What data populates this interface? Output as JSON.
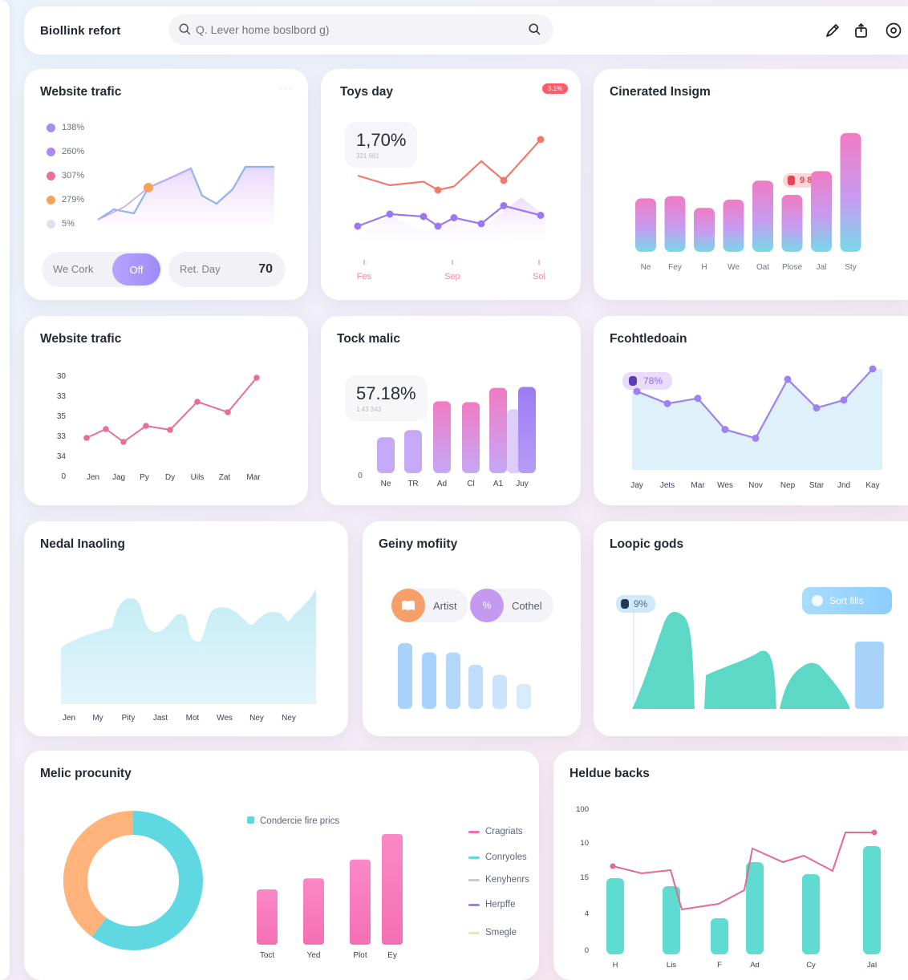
{
  "header": {
    "app_title": "Biollink refort",
    "search_placeholder": "Q. Lever home boslbord g)",
    "icons": [
      "search-icon",
      "pencil-icon",
      "share-icon",
      "settings-icon"
    ]
  },
  "cards": {
    "traffic1": {
      "title": "Website trafic",
      "legend": [
        {
          "label": "138%",
          "color": "#a88cf5"
        },
        {
          "label": "260%",
          "color": "#a88cf5"
        },
        {
          "label": "307%",
          "color": "#ee6f9e"
        },
        {
          "label": "279%",
          "color": "#f5a25d"
        },
        {
          "label": "5%",
          "color": "#dfe0ea"
        }
      ],
      "pill_label": "We Cork",
      "toggle_label": "Off",
      "day_label": "Ret. Day",
      "day_value": "70"
    },
    "toys": {
      "title": "Toys day",
      "badge": "3.1%",
      "stat": "1,70%",
      "stat_sub": "321 661",
      "x_labels": [
        "Fes",
        "Sep",
        "Sol"
      ]
    },
    "generated": {
      "title": "Cinerated Insigm",
      "badge": "9 854",
      "categories": [
        "Ne",
        "Fey",
        "H",
        "We",
        "Oat",
        "Plose",
        "Jal",
        "Sty"
      ]
    },
    "traffic2": {
      "title": "Website trafic",
      "y_labels": [
        "30",
        "33",
        "35",
        "33",
        "34",
        "0"
      ],
      "x_labels": [
        "Jen",
        "Jag",
        "Py",
        "Dy",
        "Uils",
        "Zat",
        "Mar"
      ]
    },
    "tock": {
      "title": "Tock malic",
      "stat": "57.18%",
      "stat_sub": "1.43 343",
      "zero": "0",
      "categories": [
        "Ne",
        "TR",
        "Ad",
        "Cl",
        "A1",
        "Juy"
      ]
    },
    "feeled": {
      "title": "Fcohtledoain",
      "badge": "78%",
      "x_labels": [
        "Jay",
        "Jets",
        "Mar",
        "Wes",
        "Nov",
        "Nep",
        "Star",
        "Jnd",
        "Kay"
      ]
    },
    "nodal": {
      "title": "Nedal Inaoling",
      "x_labels": [
        "Jen",
        "My",
        "Pity",
        "Jast",
        "Mot",
        "Wes",
        "Ney",
        "Ney"
      ]
    },
    "geiny": {
      "title": "Geiny mofiity",
      "chip1": "Artist",
      "chip2": "Cothel"
    },
    "loopic": {
      "title": "Loopic gods",
      "badge": "9%",
      "action_label": "Sort fills"
    },
    "melic": {
      "title": "Melic procunity",
      "series_legend": "Condercie fire prics",
      "bar_labels": [
        "Toct",
        "Yed",
        "Plot",
        "Ey"
      ],
      "legend": [
        {
          "label": "Cragriats",
          "color": "#ee6fa6"
        },
        {
          "label": "Conryoles",
          "color": "#5fd8d6"
        },
        {
          "label": "Kenyhenrs",
          "color": "#c9c9d4"
        },
        {
          "label": "Herpffe",
          "color": "#8f86e8"
        },
        {
          "label": "Smegle",
          "color": "#d9ecb8"
        }
      ]
    },
    "heldue": {
      "title": "Heldue backs",
      "y_labels": [
        "100",
        "10",
        "15",
        "4",
        "0"
      ],
      "x_labels": [
        "H",
        "Lis",
        "F",
        "Ad",
        "Cy",
        "Jal"
      ]
    }
  },
  "chart_data": [
    {
      "type": "line",
      "title": "Website trafic",
      "series": [
        {
          "values": [
            2,
            3,
            3,
            6,
            9,
            4,
            9,
            9
          ]
        }
      ]
    },
    {
      "type": "line",
      "title": "Toys day",
      "series": [
        {
          "values": [
            66,
            58,
            61,
            54,
            57,
            78,
            62,
            96
          ]
        },
        {
          "values": [
            24,
            34,
            32,
            24,
            31,
            26,
            41,
            33
          ]
        }
      ]
    },
    {
      "type": "bar",
      "title": "Cinerated Insigm",
      "categories": [
        "Ne",
        "Fey",
        "H",
        "We",
        "Oat",
        "Plose",
        "Jal",
        "Sty"
      ],
      "values": [
        45,
        47,
        37,
        44,
        60,
        48,
        68,
        100
      ]
    },
    {
      "type": "line",
      "title": "Website trafic",
      "series": [
        {
          "values": [
            4,
            5.1,
            3.5,
            5.5,
            5,
            8.5,
            7.2,
            11.5
          ]
        }
      ]
    },
    {
      "type": "bar",
      "title": "Tock malic",
      "categories": [
        "Ne",
        "TR",
        "Ad",
        "Cl",
        "A1",
        "Juy"
      ],
      "values": [
        40,
        48,
        80,
        79,
        95,
        96
      ]
    },
    {
      "type": "area",
      "title": "Fcohtledoain",
      "categories": [
        "Jay",
        "Jets",
        "Mar",
        "Wes",
        "Nov",
        "Nep",
        "Star",
        "Jnd",
        "Kay"
      ],
      "values": [
        74,
        60,
        66,
        30,
        20,
        88,
        55,
        64,
        100
      ]
    },
    {
      "type": "area",
      "title": "Nedal Inaoling",
      "categories": [
        "Jen",
        "My",
        "Pity",
        "Jast",
        "Mot",
        "Wes",
        "Ney",
        "Ney"
      ],
      "values": [
        30,
        55,
        40,
        60,
        45,
        90,
        50,
        100
      ]
    },
    {
      "type": "bar",
      "title": "Geiny mofiity",
      "values": [
        100,
        86,
        86,
        67,
        52,
        38
      ]
    },
    {
      "type": "area",
      "title": "Loopic gods",
      "values": [
        100,
        58,
        48,
        70
      ]
    },
    {
      "type": "pie",
      "title": "Melic procunity",
      "values": [
        60,
        40
      ]
    },
    {
      "type": "bar",
      "title": "Melic procunity",
      "categories": [
        "Toct",
        "Yed",
        "Plot",
        "Ey"
      ],
      "values": [
        50,
        60,
        77,
        100
      ]
    },
    {
      "type": "bar",
      "title": "Heldue backs",
      "categories": [
        "H",
        "Lis",
        "F",
        "Ad",
        "Cy",
        "Jal"
      ],
      "values": [
        9.5,
        8.5,
        4.5,
        11.5,
        10,
        13.5
      ],
      "line": [
        11,
        10.1,
        10.5,
        5.6,
        6.3,
        8,
        13.2,
        11.5,
        12.3,
        10.4,
        15.2,
        15.2
      ]
    }
  ]
}
